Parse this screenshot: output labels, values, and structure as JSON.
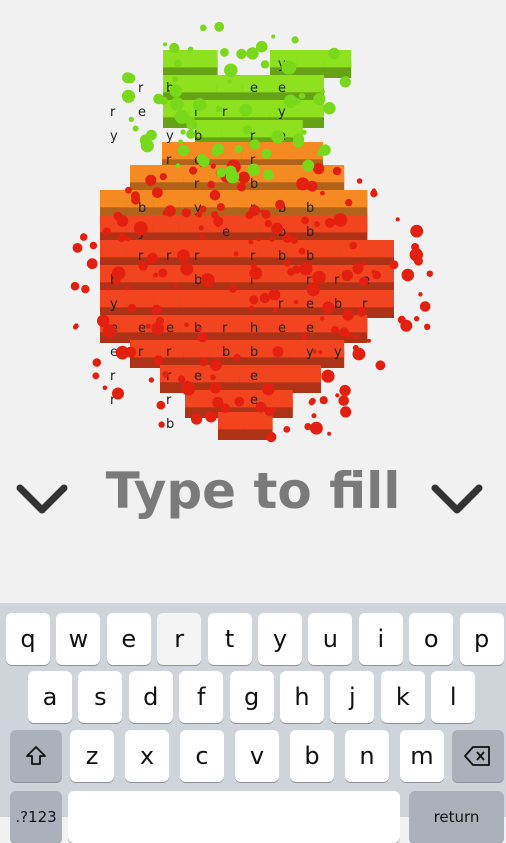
{
  "game": {
    "title": "Type to fill",
    "colors": {
      "background": "#f1f1f1",
      "green_block": "#8ee11e",
      "orange_block": "#f58a23",
      "red_block": "#f2451f",
      "red_ball": "#e3200f",
      "green_ball": "#7ad81a",
      "title": "#7a7a7a"
    },
    "left_arrow_icon": "chevron-down-icon",
    "right_arrow_icon": "chevron-down-icon",
    "letter_grid": [
      "......y",
      ".rb..ee",
      "re.rr.y",
      "y.yb.re",
      "..re.r.",
      "...r.b..",
      ".b.y.rbb",
      ".y..e.bb..",
      ".rrr.rbb.",
      "b..b.r.rre",
      "y.....rebr",
      "eeebrhee..",
      "err.bb.yy",
      "r.re.e..",
      "r.r..e..",
      "..b....."
    ]
  },
  "keyboard": {
    "row1": [
      "q",
      "w",
      "e",
      "r",
      "t",
      "y",
      "u",
      "i",
      "o",
      "p"
    ],
    "row2": [
      "a",
      "s",
      "d",
      "f",
      "g",
      "h",
      "j",
      "k",
      "l"
    ],
    "row3": [
      "z",
      "x",
      "c",
      "v",
      "b",
      "n",
      "m"
    ],
    "shift_icon": "shift-icon",
    "backspace_icon": "backspace-icon",
    "numbers_label": ".?123",
    "return_label": "return"
  }
}
